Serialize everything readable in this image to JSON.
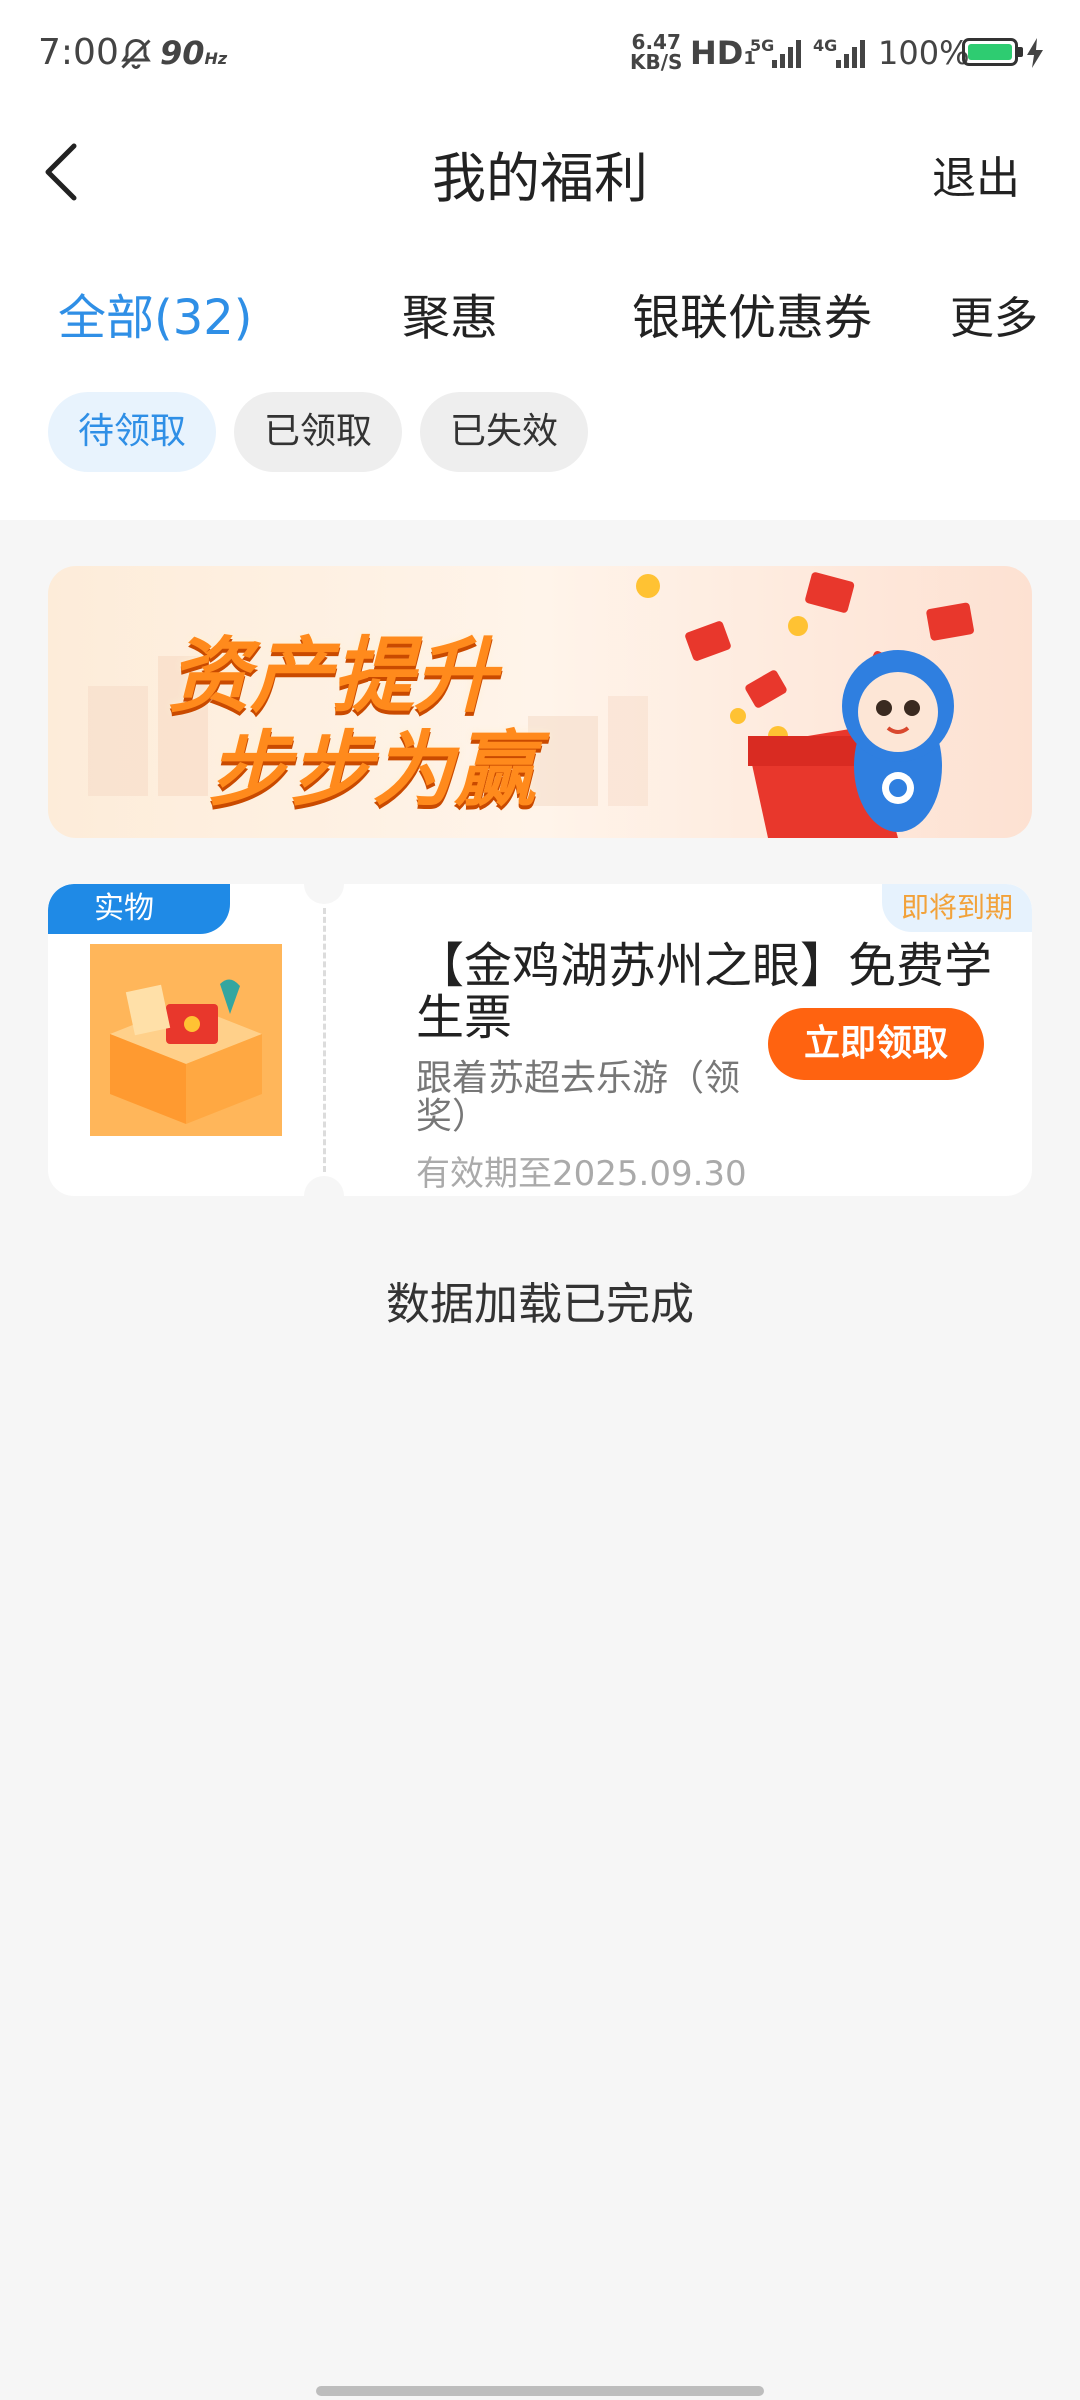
{
  "status_bar": {
    "time": "7:00",
    "refresh_rate": "90",
    "refresh_unit": "Hz",
    "net_speed_value": "6.47",
    "net_speed_unit": "KB/S",
    "hd": "HD",
    "hd_sub": "1",
    "net_5g": "5G",
    "net_4g": "4G",
    "battery": "100%"
  },
  "header": {
    "title": "我的福利",
    "exit_label": "退出"
  },
  "tabs": [
    {
      "label": "全部(32)",
      "active": true
    },
    {
      "label": "聚惠",
      "active": false
    },
    {
      "label": "银联优惠券",
      "active": false
    },
    {
      "label": "更多",
      "active": false
    }
  ],
  "filters": [
    {
      "label": "待领取",
      "selected": true
    },
    {
      "label": "已领取",
      "selected": false
    },
    {
      "label": "已失效",
      "selected": false
    }
  ],
  "banner": {
    "line1": "资产提升",
    "line2": "步步为赢"
  },
  "prize_card": {
    "tag": "实物",
    "expiry_badge": "即将到期",
    "title": "【金鸡湖苏州之眼】免费学生票",
    "description": "跟着苏超去乐游（领奖）",
    "valid_until": "有效期至2025.09.30",
    "claim_label": "立即领取"
  },
  "footer": {
    "load_complete": "数据加载已完成"
  },
  "colors": {
    "accent": "#2f8fe6",
    "claim_button": "#ff6310",
    "expiring": "#f2a23a"
  }
}
